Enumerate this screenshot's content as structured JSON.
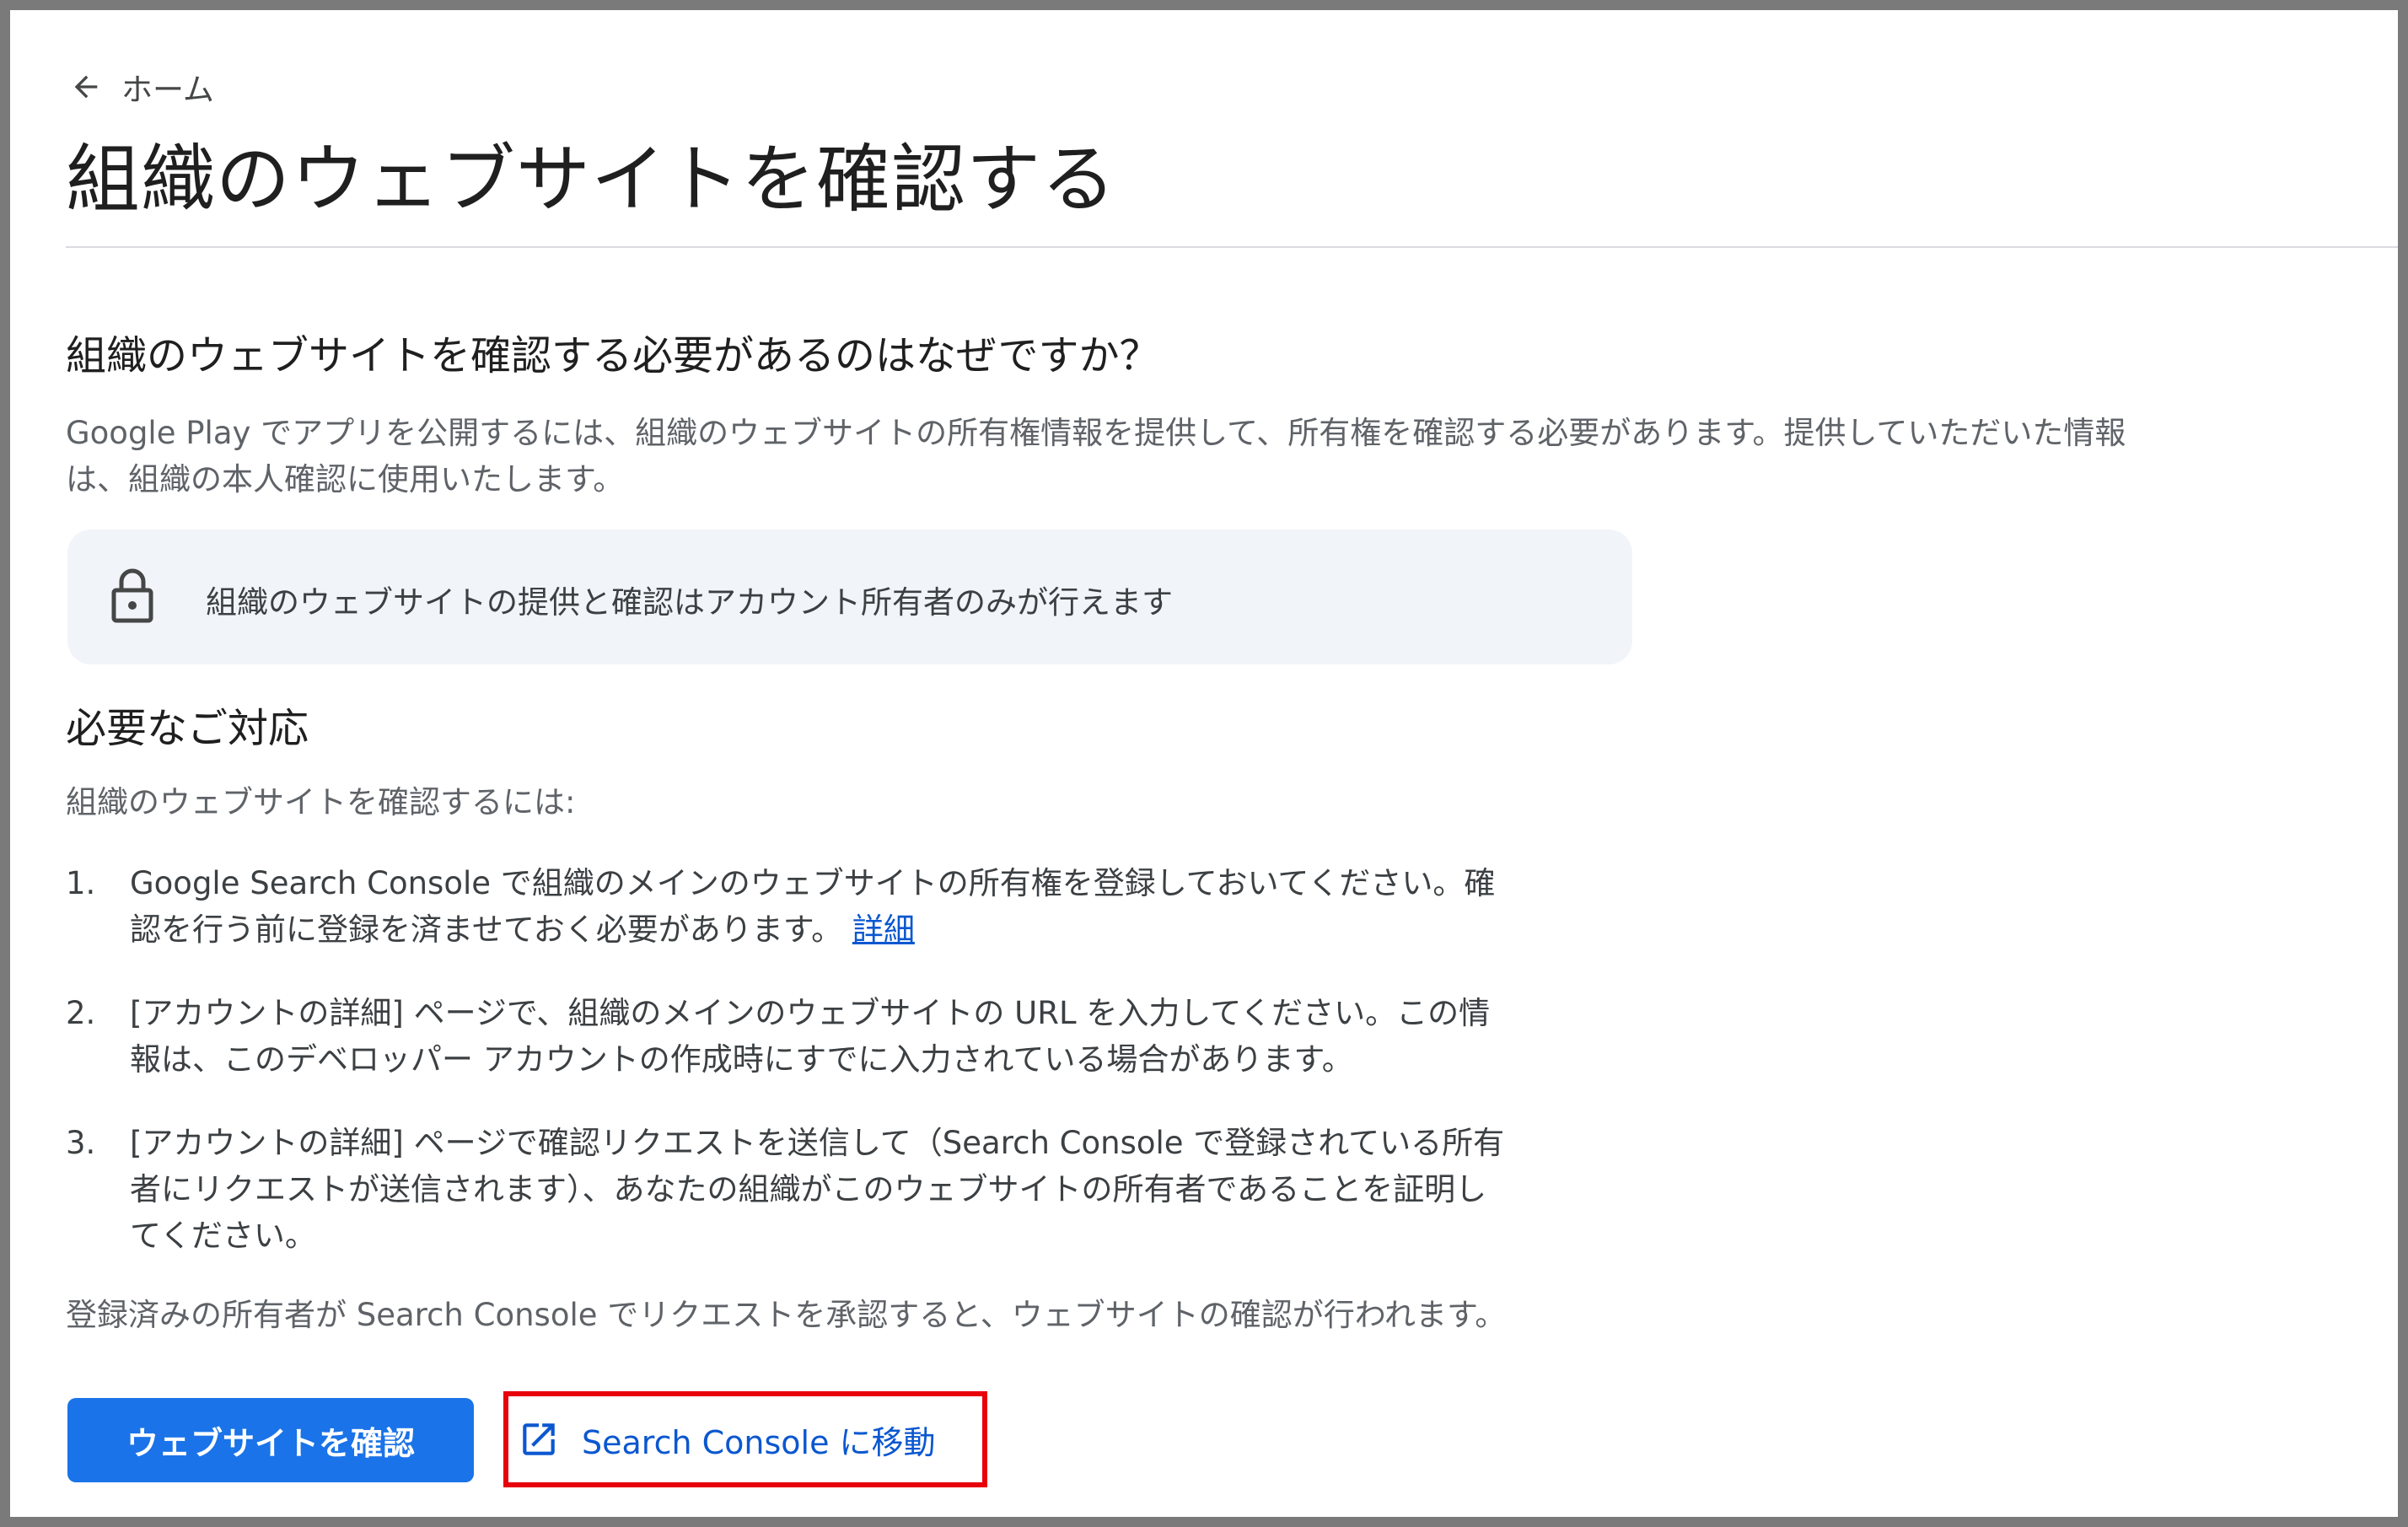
{
  "nav": {
    "back_label": "ホーム"
  },
  "page": {
    "title": "組織のウェブサイトを確認する"
  },
  "why_section": {
    "heading": "組織のウェブサイトを確認する必要があるのはなぜですか？",
    "body": "Google Play でアプリを公開するには、組織のウェブサイトの所有権情報を提供して、所有権を確認する必要があります。提供していただいた情報は、組織の本人確認に使用いたします。"
  },
  "notice": {
    "icon": "lock-icon",
    "text": "組織のウェブサイトの提供と確認はアカウント所有者のみが行えます"
  },
  "action_section": {
    "heading": "必要なご対応",
    "intro": "組織のウェブサイトを確認するには:",
    "steps": [
      {
        "number": "1.",
        "text": "Google Search Console で組織のメインのウェブサイトの所有権を登録しておいてください。確認を行う前に登録を済ませておく必要があります。",
        "link_label": "詳細"
      },
      {
        "number": "2.",
        "text": "[アカウントの詳細] ページで、組織のメインのウェブサイトの URL を入力してください。この情報は、このデベロッパー アカウントの作成時にすでに入力されている場合があります。"
      },
      {
        "number": "3.",
        "text": "[アカウントの詳細] ページで確認リクエストを送信して（Search Console で登録されている所有者にリクエストが送信されます）、あなたの組織がこのウェブサイトの所有者であることを証明してください。"
      }
    ],
    "outro": "登録済みの所有者が Search Console でリクエストを承認すると、ウェブサイトの確認が行われます。"
  },
  "actions": {
    "primary_label": "ウェブサイトを確認",
    "secondary_label": "Search Console に移動",
    "secondary_icon": "open-in-new-icon"
  },
  "colors": {
    "primary": "#1a73e8",
    "link": "#0b57d0",
    "highlight": "#e8000b",
    "notice_bg": "#f1f4f9"
  }
}
